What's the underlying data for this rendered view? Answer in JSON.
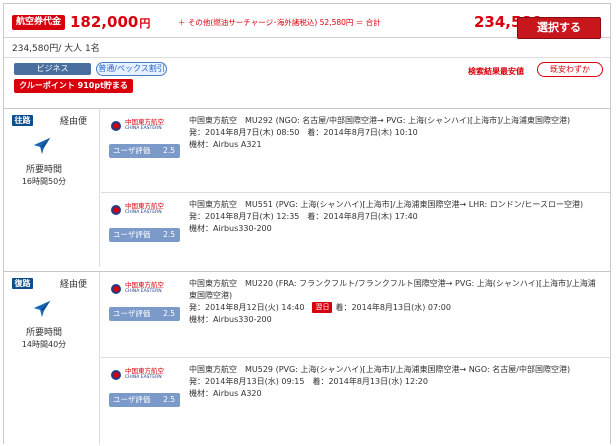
{
  "header": {
    "fare_label": "航空券代金",
    "fare_amount": "182,000",
    "fare_unit": "円",
    "extra_note": "＋ その他(燃油サーチャージ･海外諸税込) 52,580円 ＝ 合計",
    "total_amount": "234,580",
    "total_unit": "円",
    "per_person": "234,580円/ 大人 1名",
    "select_label": "選択する"
  },
  "badges": {
    "cabin": "ビジネス",
    "fare_type": "普通/ペックス割引",
    "points": "クルーポイント 910pt貯まる",
    "best_label": "検索結果最安値",
    "best_diff": "既安わずか"
  },
  "outbound": {
    "dir_label": "往路",
    "dir_type": "経由便",
    "time_label": "所要時間",
    "time_value": "16時間50分",
    "segments": [
      {
        "airline_cn": "中国東方航空",
        "airline_en": "CHINA EASTERN",
        "rating_label": "ユーザ評価",
        "rating_value": "2.5",
        "route": "中国東方航空　MU292 (NGO: 名古屋/中部国際空港→ PVG: 上海(シャンハイ)[上海市]/上海浦東国際空港)",
        "dep": "発：2014年8月7日(木) 08:50",
        "arr": "着：2014年8月7日(木) 10:10",
        "aircraft": "機材：Airbus A321"
      },
      {
        "airline_cn": "中国東方航空",
        "airline_en": "CHINA EASTERN",
        "rating_label": "ユーザ評価",
        "rating_value": "2.5",
        "route": "中国東方航空　MU551 (PVG: 上海(シャンハイ)[上海市]/上海浦東国際空港→ LHR: ロンドン/ヒースロー空港)",
        "dep": "発：2014年8月7日(木) 12:35",
        "arr": "着：2014年8月7日(木) 17:40",
        "aircraft": "機材：Airbus330-200"
      }
    ]
  },
  "return": {
    "dir_label": "復路",
    "dir_type": "経由便",
    "time_label": "所要時間",
    "time_value": "14時間40分",
    "segments": [
      {
        "airline_cn": "中国東方航空",
        "airline_en": "CHINA EASTERN",
        "rating_label": "ユーザ評価",
        "rating_value": "2.5",
        "route": "中国東方航空　MU220 (FRA: フランクフルト/フランクフルト国際空港→ PVG: 上海(シャンハイ)[上海市]/上海浦東国際空港)",
        "dep": "発：2014年8月12日(火) 14:40",
        "next_day": "翌日",
        "arr": "着：2014年8月13日(水) 07:00",
        "aircraft": "機材：Airbus330-200"
      },
      {
        "airline_cn": "中国東方航空",
        "airline_en": "CHINA EASTERN",
        "rating_label": "ユーザ評価",
        "rating_value": "2.5",
        "route": "中国東方航空　MU529 (PVG: 上海(シャンハイ)[上海市]/上海浦東国際空港→ NGO: 名古屋/中部国際空港)",
        "dep": "発：2014年8月13日(水) 09:15",
        "arr": "着：2014年8月13日(水) 12:20",
        "aircraft": "機材：Airbus A320"
      }
    ]
  },
  "colors": {
    "accent_red": "#d8000c",
    "button_red": "#c8161d",
    "direction_blue": "#0d4e8c",
    "rating_blue": "#7b9ac9"
  },
  "icons": {
    "plane": "airplane-icon",
    "airline": "china-eastern-logo-icon"
  }
}
